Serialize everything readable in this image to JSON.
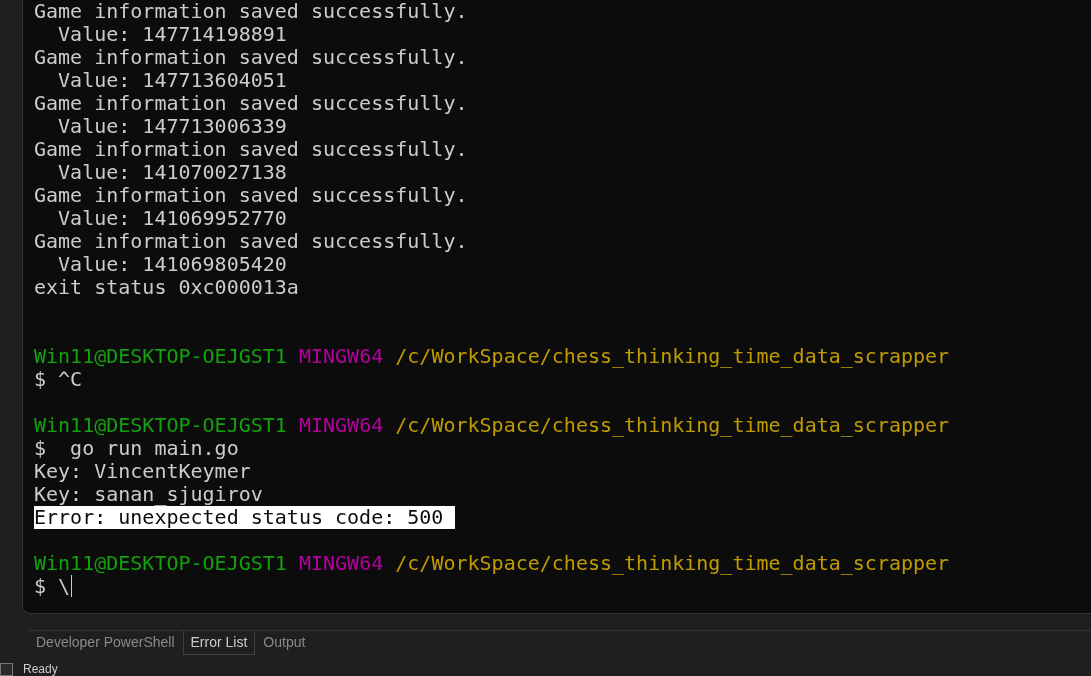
{
  "terminal": {
    "lines": [
      {
        "kind": "output",
        "text": "Game information saved successfully."
      },
      {
        "kind": "output",
        "text": "  Value: 147714198891"
      },
      {
        "kind": "output",
        "text": "Game information saved successfully."
      },
      {
        "kind": "output",
        "text": "  Value: 147713604051"
      },
      {
        "kind": "output",
        "text": "Game information saved successfully."
      },
      {
        "kind": "output",
        "text": "  Value: 147713006339"
      },
      {
        "kind": "output",
        "text": "Game information saved successfully."
      },
      {
        "kind": "output",
        "text": "  Value: 141070027138"
      },
      {
        "kind": "output",
        "text": "Game information saved successfully."
      },
      {
        "kind": "output",
        "text": "  Value: 141069952770"
      },
      {
        "kind": "output",
        "text": "Game information saved successfully."
      },
      {
        "kind": "output",
        "text": "  Value: 141069805420"
      },
      {
        "kind": "output",
        "text": "exit status 0xc000013a"
      },
      {
        "kind": "blank"
      },
      {
        "kind": "blank"
      },
      {
        "kind": "prompt",
        "user": "Win11@DESKTOP-OEJGST1",
        "system": "MINGW64",
        "path": "/c/WorkSpace/chess_thinking_time_data_scrapper"
      },
      {
        "kind": "command",
        "text": "$ ^C",
        "cursor": false
      },
      {
        "kind": "blank"
      },
      {
        "kind": "prompt",
        "user": "Win11@DESKTOP-OEJGST1",
        "system": "MINGW64",
        "path": "/c/WorkSpace/chess_thinking_time_data_scrapper"
      },
      {
        "kind": "command",
        "text": "$  go run main.go",
        "cursor": false
      },
      {
        "kind": "output",
        "text": "Key: VincentKeymer"
      },
      {
        "kind": "output",
        "text": "Key: sanan_sjugirov"
      },
      {
        "kind": "output",
        "text": "Error: unexpected status code: 500 ",
        "highlighted": true
      },
      {
        "kind": "blank"
      },
      {
        "kind": "prompt",
        "user": "Win11@DESKTOP-OEJGST1",
        "system": "MINGW64",
        "path": "/c/WorkSpace/chess_thinking_time_data_scrapper"
      },
      {
        "kind": "command",
        "text": "$ \\",
        "cursor": true
      }
    ]
  },
  "tabs": [
    {
      "label": "Developer PowerShell",
      "selected": false
    },
    {
      "label": "Error List",
      "selected": true
    },
    {
      "label": "Output",
      "selected": false
    }
  ],
  "status_bar": {
    "text": "Ready"
  }
}
